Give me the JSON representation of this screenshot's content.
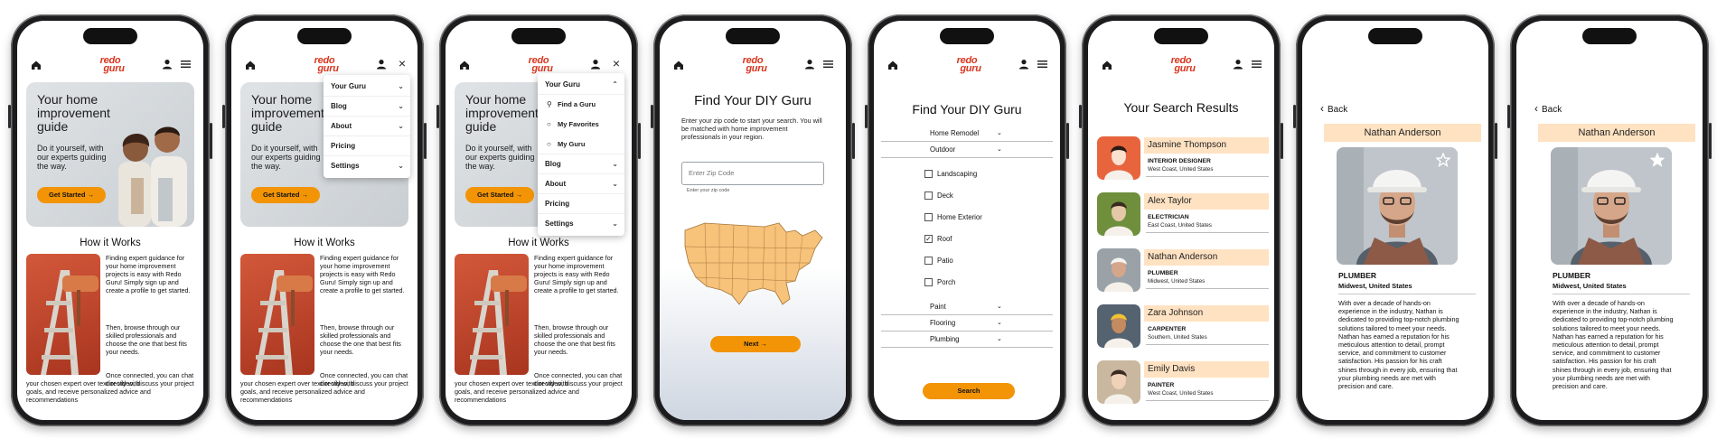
{
  "brand": {
    "logo_line1": "redo",
    "logo_line2": "guru",
    "accent": "#f29405",
    "logo_color": "#d8361f",
    "band_color": "#ffe2c2"
  },
  "home": {
    "hero_title": "Your home improvement guide",
    "hero_subtitle": "Do it yourself, with our experts guiding the way.",
    "hero_button": "Get Started →",
    "how_title": "How it Works",
    "p1": "Finding expert guidance for your home improvement projects is easy with Redo Guru! Simply sign up and create a profile to get started.",
    "p2": "Then, browse through our skilled professionals and choose the one that best fits your needs.",
    "p3": "Once connected, you can chat directly with",
    "p4": "your chosen expert over text or video, discuss your project goals, and receive personalized advice and recommendations"
  },
  "menu": {
    "your_guru": "Your Guru",
    "blog": "Blog",
    "about": "About",
    "pricing": "Pricing",
    "settings": "Settings",
    "find_guru": "Find a Guru",
    "my_favorites": "My Favorites",
    "my_guru": "My Guru"
  },
  "zip": {
    "title": "Find Your DIY Guru",
    "description": "Enter your zip code to start your search. You will be matched with home improvement professionals in your region.",
    "placeholder": "Enter Zip Code",
    "helper": "Enter your zip code",
    "next": "Next →"
  },
  "filter": {
    "title": "Find Your DIY Guru",
    "home_remodel": "Home Remodel",
    "outdoor": "Outdoor",
    "options": [
      "Landscaping",
      "Deck",
      "Home Exterior",
      "Roof",
      "Patio",
      "Porch"
    ],
    "checked": [
      false,
      false,
      false,
      true,
      false,
      false
    ],
    "check_mark": "✓",
    "paint": "Paint",
    "flooring": "Flooring",
    "plumbing": "Plumbing",
    "search": "Search"
  },
  "results": {
    "title": "Your Search Results",
    "items": [
      {
        "name": "Jasmine Thompson",
        "role": "INTERIOR DESIGNER",
        "location": "West Coast, United States"
      },
      {
        "name": "Alex Taylor",
        "role": "ELECTRICIAN",
        "location": "East Coast, United States"
      },
      {
        "name": "Nathan Anderson",
        "role": "PLUMBER",
        "location": "Midwest, United States"
      },
      {
        "name": "Zara Johnson",
        "role": "CARPENTER",
        "location": "Southern, United States"
      },
      {
        "name": "Emily Davis",
        "role": "PAINTER",
        "location": "West Coast, United States"
      }
    ]
  },
  "profile": {
    "back": "Back",
    "name": "Nathan Anderson",
    "role": "PLUMBER",
    "location": "Midwest, United States",
    "bio": "With over a decade of hands-on experience in the industry, Nathan is dedicated to providing top-notch plumbing solutions tailored to meet your needs. Nathan has earned a reputation for his meticulous attention to detail, prompt service, and commitment to customer satisfaction. His passion for his craft shines through in every job, ensuring that your plumbing needs are met with precision and care."
  },
  "chevron": "⌄",
  "close_glyph": "×"
}
